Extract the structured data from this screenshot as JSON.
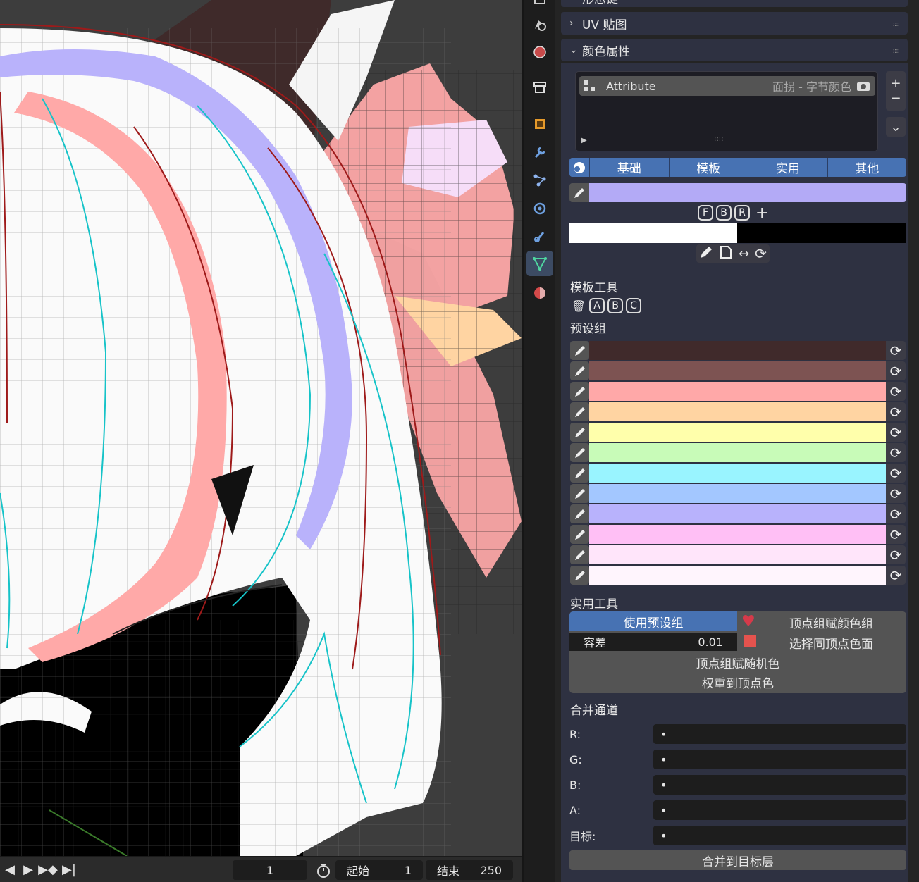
{
  "sections": {
    "top_partial": "形态键",
    "uv_maps": "UV 贴图",
    "color_attributes": "颜色属性"
  },
  "attribute": {
    "name": "Attribute",
    "info": "面拐 - 字节颜色"
  },
  "mode_tabs": [
    "基础",
    "模板",
    "实用",
    "其他"
  ],
  "active_color": "#b3aaf6",
  "channel_keys": [
    "F",
    "B",
    "R"
  ],
  "template_tools": {
    "title": "模板工具",
    "keys": [
      "A",
      "B",
      "C"
    ]
  },
  "preset_group": {
    "title": "预设组",
    "colors": [
      "#402a2b",
      "#7d5352",
      "#ffa8a8",
      "#ffd4a2",
      "#ffffab",
      "#c8fbb8",
      "#99f4ff",
      "#a3c7ff",
      "#b8b2fc",
      "#ffbff5",
      "#ffe5fa",
      "#fff5fd"
    ]
  },
  "utility": {
    "title": "实用工具",
    "use_preset": "使用预设组",
    "tolerance_label": "容差",
    "tolerance_value": "0.01",
    "vgroup_color": "顶点组赋颜色组",
    "select_same": "选择同顶点色面",
    "random_color": "顶点组赋随机色",
    "weight_to_color": "权重到顶点色"
  },
  "merge": {
    "title": "合并通道",
    "rows": [
      {
        "label": "R:",
        "value": "•"
      },
      {
        "label": "G:",
        "value": "•"
      },
      {
        "label": "B:",
        "value": "•"
      },
      {
        "label": "A:",
        "value": "•"
      },
      {
        "label": "目标:",
        "value": "•"
      }
    ],
    "button": "合并到目标层"
  },
  "timeline": {
    "current_frame": "1",
    "start_label": "起始",
    "start_value": "1",
    "end_label": "结束",
    "end_value": "250"
  }
}
